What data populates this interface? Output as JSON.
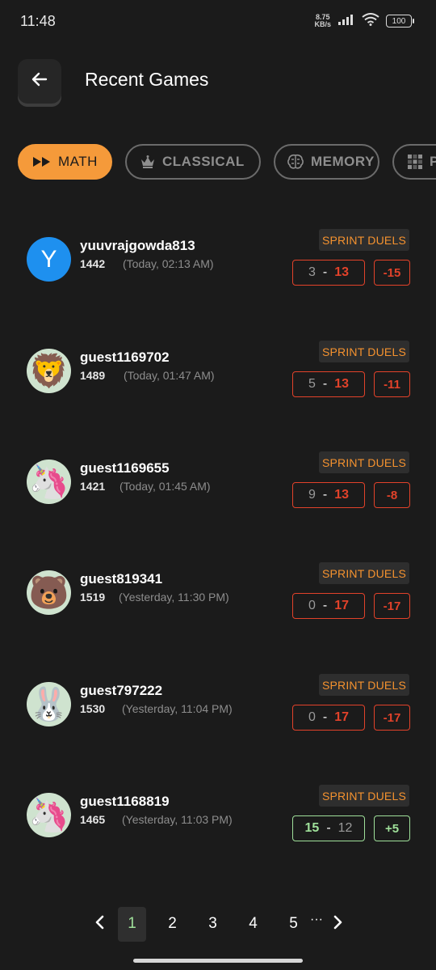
{
  "status_bar": {
    "time": "11:48",
    "net_speed_value": "8.75",
    "net_speed_unit": "KB/s",
    "battery": "100"
  },
  "header": {
    "back_icon": "arrow-left-icon",
    "title": "Recent Games"
  },
  "tabs": [
    {
      "label": "MATH",
      "icon": "fast-forward-icon",
      "active": true
    },
    {
      "label": "CLASSICAL",
      "icon": "crown-icon",
      "active": false
    },
    {
      "label": "MEMORY",
      "icon": "brain-icon",
      "active": false
    },
    {
      "label": "P",
      "icon": "grid-icon",
      "active": false
    }
  ],
  "games": [
    {
      "avatar": "Y",
      "avatar_type": "letter",
      "username": "yuuvrajgowda813",
      "rating": "1442",
      "time": "(Today, 02:13 AM)",
      "mode": "SPRINT DUELS",
      "my_score": "3",
      "opp_score": "13",
      "delta": "-15",
      "result": "loss"
    },
    {
      "avatar": "🦁",
      "avatar_type": "emoji",
      "username": "guest1169702",
      "rating": "1489",
      "time": "(Today, 01:47 AM)",
      "mode": "SPRINT DUELS",
      "my_score": "5",
      "opp_score": "13",
      "delta": "-11",
      "result": "loss"
    },
    {
      "avatar": "🦄",
      "avatar_type": "emoji",
      "username": "guest1169655",
      "rating": "1421",
      "time": "(Today, 01:45 AM)",
      "mode": "SPRINT DUELS",
      "my_score": "9",
      "opp_score": "13",
      "delta": "-8",
      "result": "loss"
    },
    {
      "avatar": "🐻",
      "avatar_type": "emoji",
      "username": "guest819341",
      "rating": "1519",
      "time": "(Yesterday, 11:30 PM)",
      "mode": "SPRINT DUELS",
      "my_score": "0",
      "opp_score": "17",
      "delta": "-17",
      "result": "loss"
    },
    {
      "avatar": "🐰",
      "avatar_type": "emoji",
      "username": "guest797222",
      "rating": "1530",
      "time": "(Yesterday, 11:04 PM)",
      "mode": "SPRINT DUELS",
      "my_score": "0",
      "opp_score": "17",
      "delta": "-17",
      "result": "loss"
    },
    {
      "avatar": "🦄",
      "avatar_type": "emoji",
      "username": "guest1168819",
      "rating": "1465",
      "time": "(Yesterday, 11:03 PM)",
      "mode": "SPRINT DUELS",
      "my_score": "15",
      "opp_score": "12",
      "delta": "+5",
      "result": "win"
    }
  ],
  "pagination": {
    "pages": [
      "1",
      "2",
      "3",
      "4",
      "5"
    ],
    "current": "1",
    "ellipsis": "···"
  },
  "colors": {
    "accent": "#f59a3a",
    "loss": "#e2422a",
    "win": "#9fe09a",
    "background": "#1b1b1b"
  }
}
